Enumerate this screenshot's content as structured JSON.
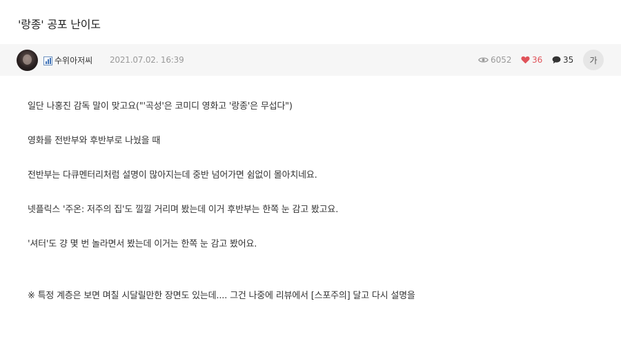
{
  "post": {
    "title": "'랑종' 공포 난이도"
  },
  "meta": {
    "author": "수위아저씨",
    "date": "2021.07.02. 16:39",
    "views": "6052",
    "likes": "36",
    "comments": "35",
    "font_button_label": "가"
  },
  "icons": {
    "views": "eye-icon",
    "likes": "heart-icon",
    "comments": "speech-bubble-icon",
    "level": "level-bar-icon"
  },
  "colors": {
    "like_red": "#e0535a",
    "meta_bg": "#f6f6f6",
    "muted": "#9a9a9a"
  },
  "body": {
    "paragraphs": [
      "일단 나홍진 감독 말이 맞고요(\"'곡성'은 코미디 영화고 '랑종'은 무섭다\")",
      "영화를 전반부와 후반부로 나눴을 때",
      "전반부는 다큐멘터리처럼 설명이 많아지는데 중반 넘어가면 쉼없이 몰아치네요.",
      "넷플릭스 '주온: 저주의 집'도 낄낄 거리며 봤는데 이거 후반부는 한쪽 눈 감고 봤고요.",
      "'셔터'도 걍 몇 번 놀라면서 봤는데 이거는 한쪽 눈 감고 봤어요.",
      "※ 특정 계층은 보면 며칠 시달릴만한 장면도 있는데.... 그건 나중에 리뷰에서 [스포주의] 달고 다시 설명을"
    ]
  }
}
